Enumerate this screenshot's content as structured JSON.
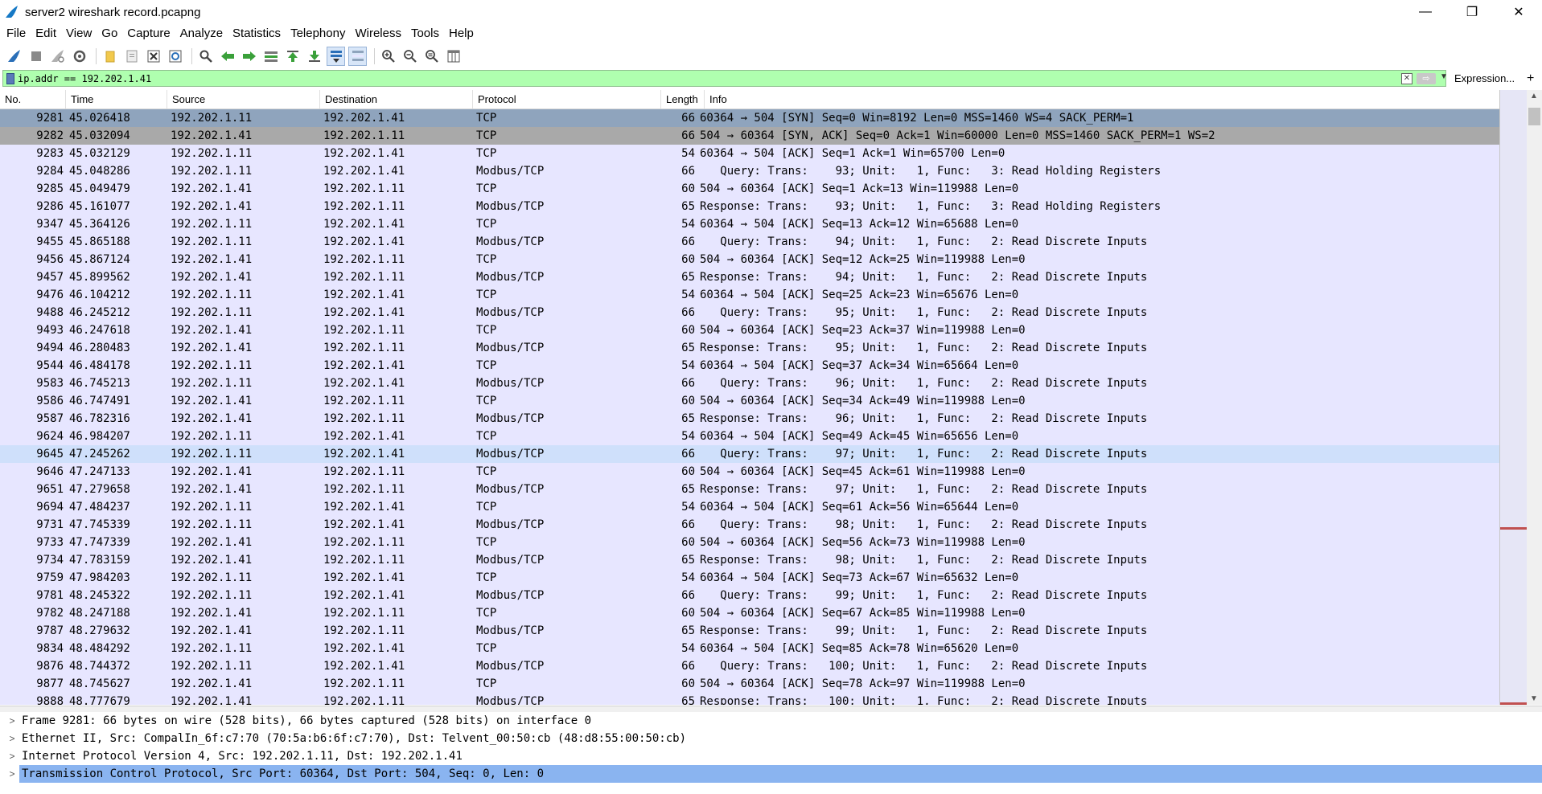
{
  "window": {
    "title": "server2 wireshark record.pcapng",
    "minimize": "—",
    "maximize": "❐",
    "close": "✕"
  },
  "menu": [
    "File",
    "Edit",
    "View",
    "Go",
    "Capture",
    "Analyze",
    "Statistics",
    "Telephony",
    "Wireless",
    "Tools",
    "Help"
  ],
  "filter": {
    "value": "ip.addr == 192.202.1.41",
    "expression_label": "Expression...",
    "plus_label": "+"
  },
  "columns": [
    "No.",
    "Time",
    "Source",
    "Destination",
    "Protocol",
    "Length",
    "Info"
  ],
  "packets": [
    [
      "9281",
      "45.026418",
      "192.202.1.11",
      "192.202.1.41",
      "TCP",
      "66",
      "60364 → 504 [SYN] Seq=0 Win=8192 Len=0 MSS=1460 WS=4 SACK_PERM=1"
    ],
    [
      "9282",
      "45.032094",
      "192.202.1.41",
      "192.202.1.11",
      "TCP",
      "66",
      "504 → 60364 [SYN, ACK] Seq=0 Ack=1 Win=60000 Len=0 MSS=1460 SACK_PERM=1 WS=2"
    ],
    [
      "9283",
      "45.032129",
      "192.202.1.11",
      "192.202.1.41",
      "TCP",
      "54",
      "60364 → 504 [ACK] Seq=1 Ack=1 Win=65700 Len=0"
    ],
    [
      "9284",
      "45.048286",
      "192.202.1.11",
      "192.202.1.41",
      "Modbus/TCP",
      "66",
      "   Query: Trans:    93; Unit:   1, Func:   3: Read Holding Registers"
    ],
    [
      "9285",
      "45.049479",
      "192.202.1.41",
      "192.202.1.11",
      "TCP",
      "60",
      "504 → 60364 [ACK] Seq=1 Ack=13 Win=119988 Len=0"
    ],
    [
      "9286",
      "45.161077",
      "192.202.1.41",
      "192.202.1.11",
      "Modbus/TCP",
      "65",
      "Response: Trans:    93; Unit:   1, Func:   3: Read Holding Registers"
    ],
    [
      "9347",
      "45.364126",
      "192.202.1.11",
      "192.202.1.41",
      "TCP",
      "54",
      "60364 → 504 [ACK] Seq=13 Ack=12 Win=65688 Len=0"
    ],
    [
      "9455",
      "45.865188",
      "192.202.1.11",
      "192.202.1.41",
      "Modbus/TCP",
      "66",
      "   Query: Trans:    94; Unit:   1, Func:   2: Read Discrete Inputs"
    ],
    [
      "9456",
      "45.867124",
      "192.202.1.41",
      "192.202.1.11",
      "TCP",
      "60",
      "504 → 60364 [ACK] Seq=12 Ack=25 Win=119988 Len=0"
    ],
    [
      "9457",
      "45.899562",
      "192.202.1.41",
      "192.202.1.11",
      "Modbus/TCP",
      "65",
      "Response: Trans:    94; Unit:   1, Func:   2: Read Discrete Inputs"
    ],
    [
      "9476",
      "46.104212",
      "192.202.1.11",
      "192.202.1.41",
      "TCP",
      "54",
      "60364 → 504 [ACK] Seq=25 Ack=23 Win=65676 Len=0"
    ],
    [
      "9488",
      "46.245212",
      "192.202.1.11",
      "192.202.1.41",
      "Modbus/TCP",
      "66",
      "   Query: Trans:    95; Unit:   1, Func:   2: Read Discrete Inputs"
    ],
    [
      "9493",
      "46.247618",
      "192.202.1.41",
      "192.202.1.11",
      "TCP",
      "60",
      "504 → 60364 [ACK] Seq=23 Ack=37 Win=119988 Len=0"
    ],
    [
      "9494",
      "46.280483",
      "192.202.1.41",
      "192.202.1.11",
      "Modbus/TCP",
      "65",
      "Response: Trans:    95; Unit:   1, Func:   2: Read Discrete Inputs"
    ],
    [
      "9544",
      "46.484178",
      "192.202.1.11",
      "192.202.1.41",
      "TCP",
      "54",
      "60364 → 504 [ACK] Seq=37 Ack=34 Win=65664 Len=0"
    ],
    [
      "9583",
      "46.745213",
      "192.202.1.11",
      "192.202.1.41",
      "Modbus/TCP",
      "66",
      "   Query: Trans:    96; Unit:   1, Func:   2: Read Discrete Inputs"
    ],
    [
      "9586",
      "46.747491",
      "192.202.1.41",
      "192.202.1.11",
      "TCP",
      "60",
      "504 → 60364 [ACK] Seq=34 Ack=49 Win=119988 Len=0"
    ],
    [
      "9587",
      "46.782316",
      "192.202.1.41",
      "192.202.1.11",
      "Modbus/TCP",
      "65",
      "Response: Trans:    96; Unit:   1, Func:   2: Read Discrete Inputs"
    ],
    [
      "9624",
      "46.984207",
      "192.202.1.11",
      "192.202.1.41",
      "TCP",
      "54",
      "60364 → 504 [ACK] Seq=49 Ack=45 Win=65656 Len=0"
    ],
    [
      "9645",
      "47.245262",
      "192.202.1.11",
      "192.202.1.41",
      "Modbus/TCP",
      "66",
      "   Query: Trans:    97; Unit:   1, Func:   2: Read Discrete Inputs"
    ],
    [
      "9646",
      "47.247133",
      "192.202.1.41",
      "192.202.1.11",
      "TCP",
      "60",
      "504 → 60364 [ACK] Seq=45 Ack=61 Win=119988 Len=0"
    ],
    [
      "9651",
      "47.279658",
      "192.202.1.41",
      "192.202.1.11",
      "Modbus/TCP",
      "65",
      "Response: Trans:    97; Unit:   1, Func:   2: Read Discrete Inputs"
    ],
    [
      "9694",
      "47.484237",
      "192.202.1.11",
      "192.202.1.41",
      "TCP",
      "54",
      "60364 → 504 [ACK] Seq=61 Ack=56 Win=65644 Len=0"
    ],
    [
      "9731",
      "47.745339",
      "192.202.1.11",
      "192.202.1.41",
      "Modbus/TCP",
      "66",
      "   Query: Trans:    98; Unit:   1, Func:   2: Read Discrete Inputs"
    ],
    [
      "9733",
      "47.747339",
      "192.202.1.41",
      "192.202.1.11",
      "TCP",
      "60",
      "504 → 60364 [ACK] Seq=56 Ack=73 Win=119988 Len=0"
    ],
    [
      "9734",
      "47.783159",
      "192.202.1.41",
      "192.202.1.11",
      "Modbus/TCP",
      "65",
      "Response: Trans:    98; Unit:   1, Func:   2: Read Discrete Inputs"
    ],
    [
      "9759",
      "47.984203",
      "192.202.1.11",
      "192.202.1.41",
      "TCP",
      "54",
      "60364 → 504 [ACK] Seq=73 Ack=67 Win=65632 Len=0"
    ],
    [
      "9781",
      "48.245322",
      "192.202.1.11",
      "192.202.1.41",
      "Modbus/TCP",
      "66",
      "   Query: Trans:    99; Unit:   1, Func:   2: Read Discrete Inputs"
    ],
    [
      "9782",
      "48.247188",
      "192.202.1.41",
      "192.202.1.11",
      "TCP",
      "60",
      "504 → 60364 [ACK] Seq=67 Ack=85 Win=119988 Len=0"
    ],
    [
      "9787",
      "48.279632",
      "192.202.1.41",
      "192.202.1.11",
      "Modbus/TCP",
      "65",
      "Response: Trans:    99; Unit:   1, Func:   2: Read Discrete Inputs"
    ],
    [
      "9834",
      "48.484292",
      "192.202.1.11",
      "192.202.1.41",
      "TCP",
      "54",
      "60364 → 504 [ACK] Seq=85 Ack=78 Win=65620 Len=0"
    ],
    [
      "9876",
      "48.744372",
      "192.202.1.11",
      "192.202.1.41",
      "Modbus/TCP",
      "66",
      "   Query: Trans:   100; Unit:   1, Func:   2: Read Discrete Inputs"
    ],
    [
      "9877",
      "48.745627",
      "192.202.1.41",
      "192.202.1.11",
      "TCP",
      "60",
      "504 → 60364 [ACK] Seq=78 Ack=97 Win=119988 Len=0"
    ],
    [
      "9888",
      "48.777679",
      "192.202.1.41",
      "192.202.1.11",
      "Modbus/TCP",
      "65",
      "Response: Trans:   100; Unit:   1, Func:   2: Read Discrete Inputs"
    ]
  ],
  "details": [
    "Frame 9281: 66 bytes on wire (528 bits), 66 bytes captured (528 bits) on interface 0",
    "Ethernet II, Src: CompalIn_6f:c7:70 (70:5a:b6:6f:c7:70), Dst: Telvent_00:50:cb (48:d8:55:00:50:cb)",
    "Internet Protocol Version 4, Src: 192.202.1.11, Dst: 192.202.1.41",
    "Transmission Control Protocol, Src Port: 60364, Dst Port: 504, Seq: 0, Len: 0"
  ],
  "colors": {
    "row_bg": "#e7e6ff",
    "selected_row": "#8fa4bd",
    "related_row": "#a9a9a9",
    "filter_valid": "#afffaf",
    "detail_selected": "#8ab4f0"
  }
}
